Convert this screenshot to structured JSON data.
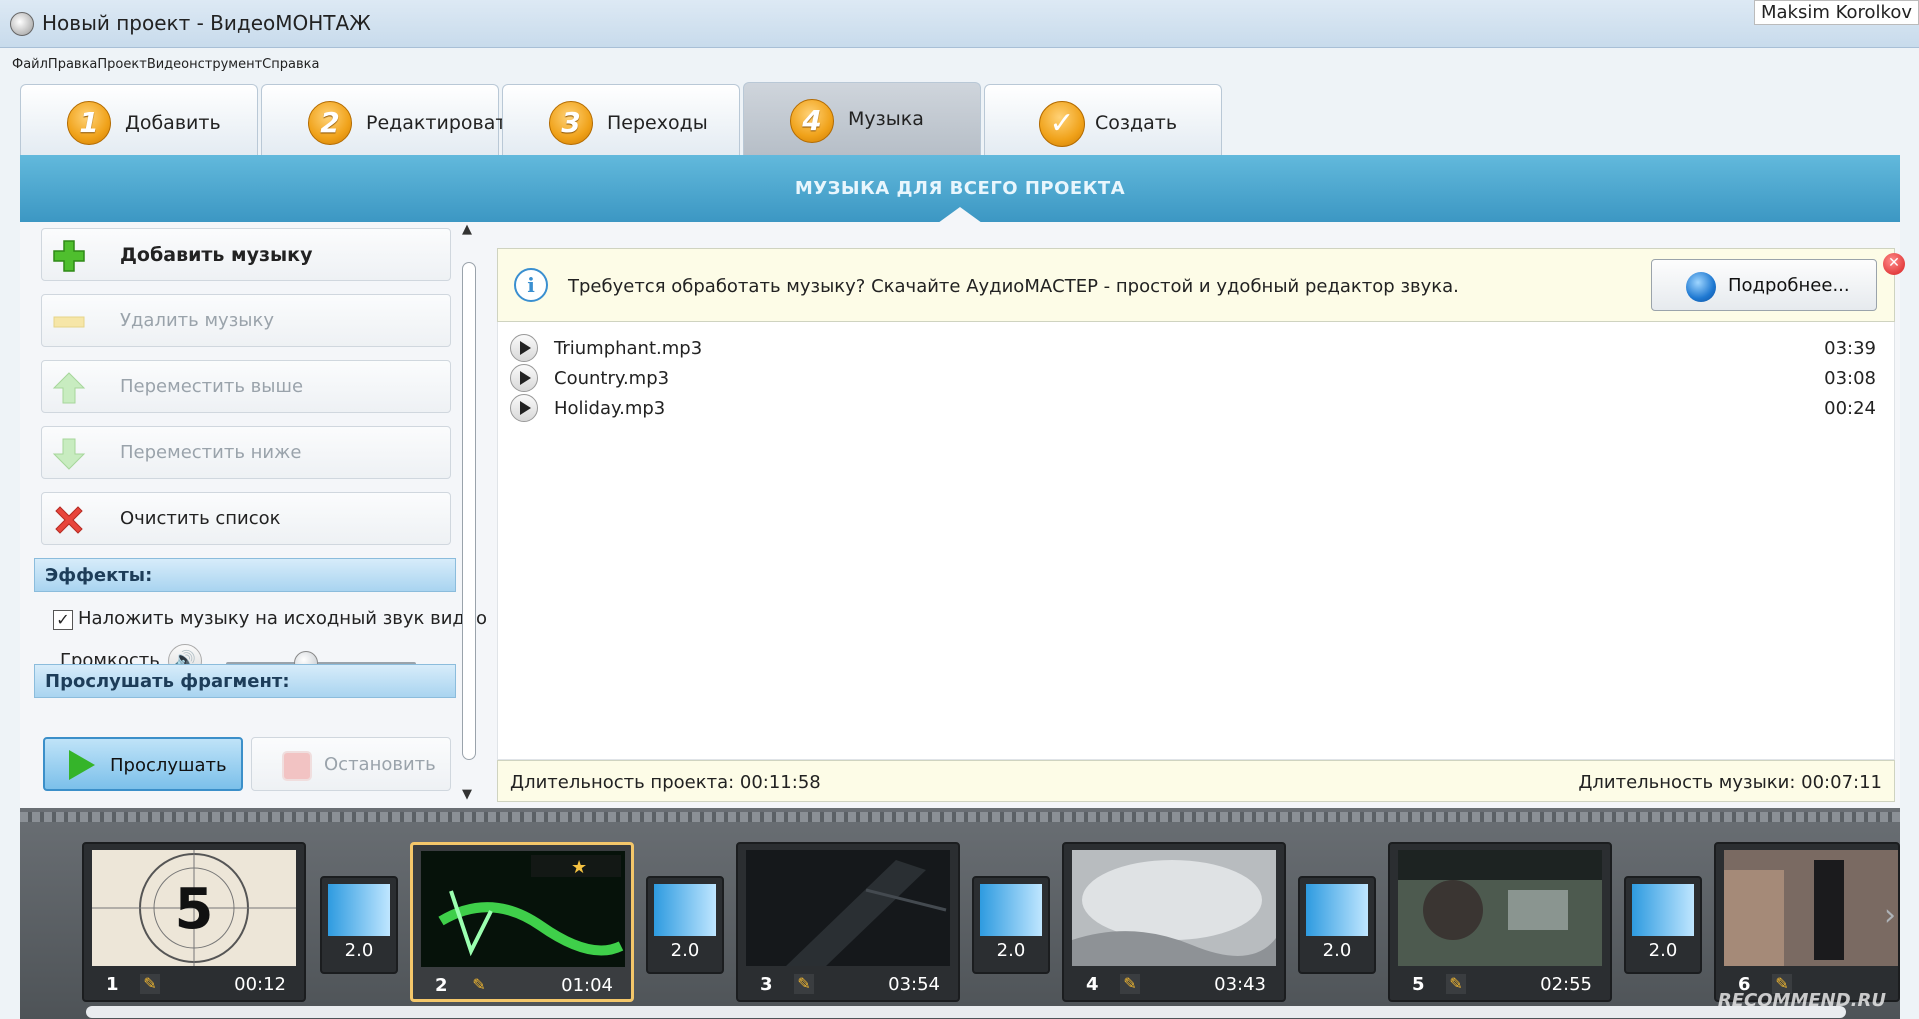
{
  "window": {
    "title": "Новый проект - ВидеоМОНТАЖ",
    "user": "Maksim Korolkov"
  },
  "menu": [
    "Файл",
    "Правка",
    "Проект",
    "Видео",
    "нструмент",
    "Справка"
  ],
  "tabs": [
    {
      "num": "1",
      "label": "Добавить"
    },
    {
      "num": "2",
      "label": "Редактировать"
    },
    {
      "num": "3",
      "label": "Переходы"
    },
    {
      "num": "4",
      "label": "Музыка"
    },
    {
      "label": "Создать"
    }
  ],
  "section_title": "МУЗЫКА ДЛЯ ВСЕГО ПРОЕКТА",
  "left": {
    "add": "Добавить музыку",
    "delete": "Удалить музыку",
    "up": "Переместить выше",
    "down": "Переместить ниже",
    "clear": "Очистить список",
    "effects_head": "Эффекты:",
    "overlay_label": "Наложить музыку на исходный звук видео",
    "overlay_checked": true,
    "volume_label": "Громкость",
    "volume_level": 0.42,
    "preview_head": "Прослушать фрагмент:",
    "play": "Прослушать",
    "stop": "Остановить"
  },
  "info": {
    "text": "Требуется обработать музыку? Скачайте АудиоМАСТЕР - простой и удобный редактор звука.",
    "button": "Подробнее..."
  },
  "tracks": [
    {
      "name": "Triumphant.mp3",
      "duration": "03:39"
    },
    {
      "name": "Country.mp3",
      "duration": "03:08"
    },
    {
      "name": "Holiday.mp3",
      "duration": "00:24"
    }
  ],
  "durations": {
    "project": "Длительность проекта: 00:11:58",
    "music": "Длительность музыки: 00:07:11"
  },
  "timeline": {
    "clips": [
      {
        "num": "1",
        "duration": "00:12"
      },
      {
        "num": "2",
        "duration": "01:04"
      },
      {
        "num": "3",
        "duration": "03:54"
      },
      {
        "num": "4",
        "duration": "03:43"
      },
      {
        "num": "5",
        "duration": "02:55"
      },
      {
        "num": "6",
        "duration": ""
      }
    ],
    "transitions": [
      "2.0",
      "2.0",
      "2.0",
      "2.0",
      "2.0"
    ],
    "countdown_digit": "5"
  },
  "watermark": "RECOMMEND.RU"
}
